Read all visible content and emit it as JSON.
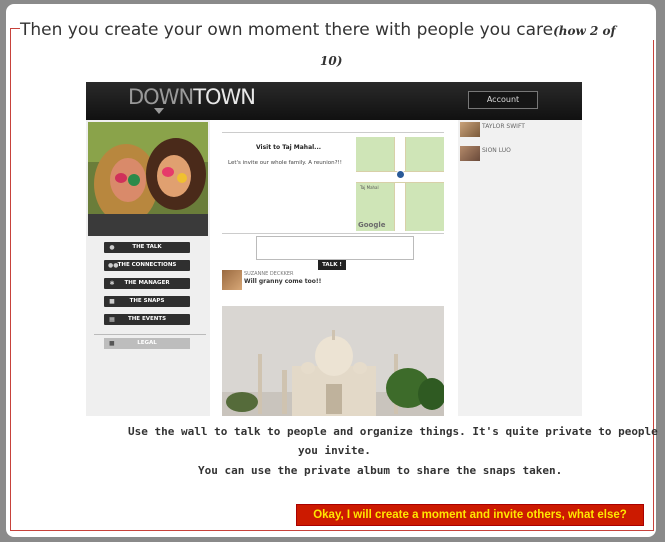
{
  "heading": {
    "title": "Then you create your own moment there with people you care",
    "progress_part1": "(how 2 of",
    "progress_part2": "10)"
  },
  "screenshot": {
    "logo_down": "DOWN",
    "logo_town": "TOWN",
    "account_label": "Account",
    "nav": [
      {
        "label": "THE TALK",
        "icon": "speech-bubble-icon"
      },
      {
        "label": "THE CONNECTIONS",
        "icon": "people-icon"
      },
      {
        "label": "THE MANAGER",
        "icon": "gear-icon"
      },
      {
        "label": "THE SNAPS",
        "icon": "camera-icon"
      },
      {
        "label": "THE EVENTS",
        "icon": "calendar-icon"
      }
    ],
    "legal_label": "LEGAL",
    "event_title": "Visit to Taj Mahal...",
    "event_description": "Let's invite our whole family. A reunion?!!",
    "map_label": "Taj Mahal",
    "map_brand": "Google",
    "talk_button": "TALK !",
    "post": {
      "author": "SUZANNE DECKKER",
      "text": "Will granny come too!!"
    },
    "friends": [
      {
        "name": "TAYLOR SWIFT"
      },
      {
        "name": "SION LUO"
      }
    ]
  },
  "description": {
    "line1": "Use the wall to talk to people and organize things. It's quite private to people",
    "line2": "you invite.",
    "line3": "You can use the private album to share the snaps taken."
  },
  "next_button": "Okay, I will create a moment and invite others, what else?",
  "colors": {
    "frame_border": "#c7423b",
    "button_bg": "#cc1a00",
    "button_text": "#ffe600"
  }
}
